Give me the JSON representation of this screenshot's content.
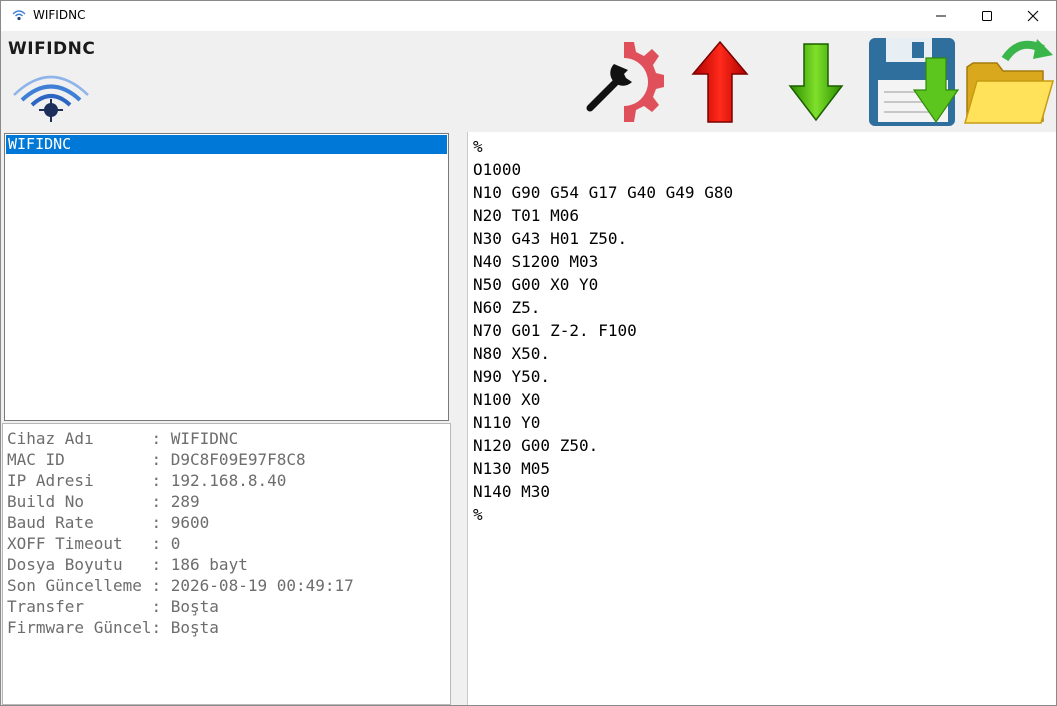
{
  "window": {
    "title": "WIFIDNC",
    "minimize_glyph": "—",
    "maximize_glyph": "☐",
    "close_glyph": "✕"
  },
  "toolbar": {
    "brand": "WIFIDNC",
    "buttons": [
      {
        "name": "settings-button",
        "icon": "wrench-gear-icon"
      },
      {
        "name": "upload-button",
        "icon": "red-up-arrow-icon"
      },
      {
        "name": "download-button",
        "icon": "green-down-arrow-icon"
      },
      {
        "name": "save-button",
        "icon": "floppy-save-icon"
      },
      {
        "name": "open-button",
        "icon": "open-folder-icon"
      }
    ]
  },
  "device_list": {
    "items": [
      "WIFIDNC"
    ],
    "selected_index": 0
  },
  "device_info": [
    {
      "label": "Cihaz Adı      ",
      "value": "WIFIDNC"
    },
    {
      "label": "MAC ID         ",
      "value": "D9C8F09E97F8C8"
    },
    {
      "label": "IP Adresi      ",
      "value": "192.168.8.40"
    },
    {
      "label": "Build No       ",
      "value": "289"
    },
    {
      "label": "Baud Rate      ",
      "value": "9600"
    },
    {
      "label": "XOFF Timeout   ",
      "value": "0"
    },
    {
      "label": "Dosya Boyutu   ",
      "value": "186 bayt"
    },
    {
      "label": "Son Güncelleme ",
      "value": "2026-08-19 00:49:17"
    },
    {
      "label": "Transfer       ",
      "value": "Boşta"
    },
    {
      "label": "Firmware Güncel",
      "value": "Boşta"
    }
  ],
  "editor": {
    "lines": [
      "%",
      "O1000",
      "N10 G90 G54 G17 G40 G49 G80",
      "N20 T01 M06",
      "N30 G43 H01 Z50.",
      "N40 S1200 M03",
      "N50 G00 X0 Y0",
      "N60 Z5.",
      "N70 G01 Z-2. F100",
      "N80 X50.",
      "N90 Y50.",
      "N100 X0",
      "N110 Y0",
      "N120 G00 Z50.",
      "N130 M05",
      "N140 M30",
      "%"
    ]
  },
  "colors": {
    "selection": "#0078d7",
    "info_text": "#6d6d6d",
    "wifi_blue": "#3f7fd6",
    "gear_red": "#e0505a",
    "arrow_red": "#e8201a",
    "arrow_green": "#4cc21a"
  }
}
